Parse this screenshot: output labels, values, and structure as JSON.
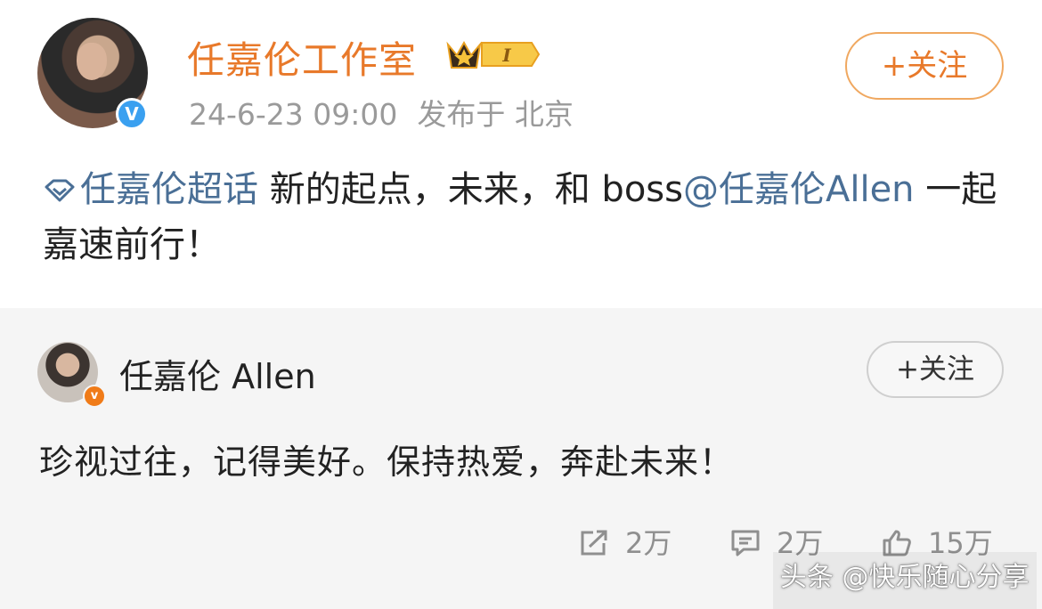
{
  "post": {
    "author_name": "任嘉伦工作室",
    "verified_badge": "V",
    "timestamp": "24-6-23 09:00",
    "source": "发布于 北京",
    "crown_badge_text": "I",
    "follow_label": "+关注",
    "topic_icon": "diamond-topic-icon",
    "topic_label": "任嘉伦超话",
    "text_part1": " 新的起点，未来，和 boss",
    "mention": "@任嘉伦Allen",
    "text_part2": " 一起嘉速前行！"
  },
  "repost": {
    "author_name": "任嘉伦 Allen",
    "verified_badge": "v",
    "follow_label": "+关注",
    "text": "珍视过往，记得美好。保持热爱，奔赴未来！",
    "actions": [
      {
        "icon": "share-icon",
        "count": "2万"
      },
      {
        "icon": "comment-icon",
        "count": "2万"
      },
      {
        "icon": "like-icon",
        "count": "15万"
      }
    ]
  },
  "watermark": "头条 @快乐随心分享",
  "colors": {
    "accent_orange": "#e8792a",
    "link_blue": "#4a6f96",
    "verified_blue": "#3aa0f0",
    "verified_orange": "#f07b18",
    "gray_text": "#9a9a9a",
    "repost_bg": "#f5f5f5"
  }
}
